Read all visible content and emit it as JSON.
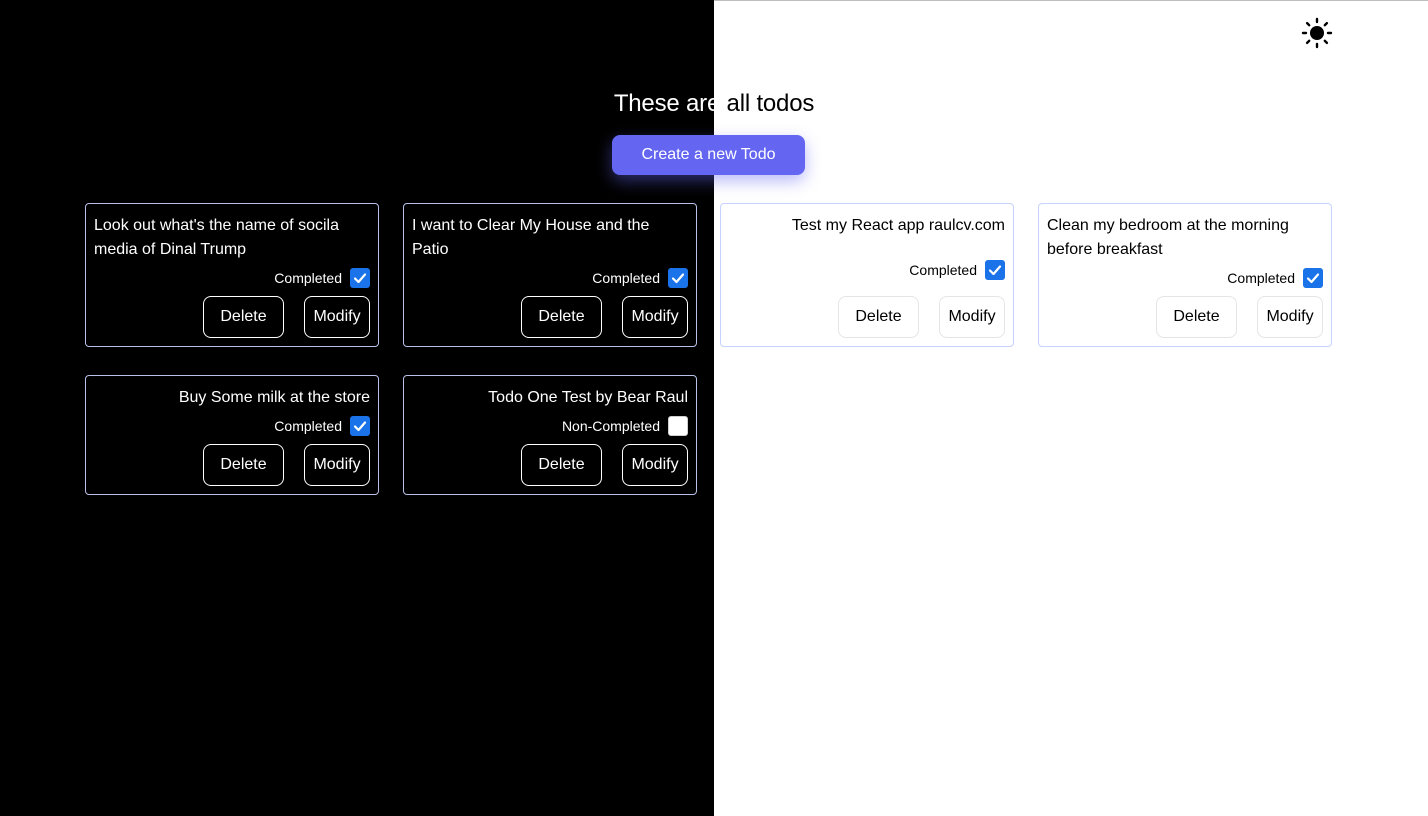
{
  "header": {
    "title": "These are all todos",
    "title_dark_part": "These are",
    "title_light_part": " all todos",
    "create_button": "Create a new Todo",
    "theme_toggle_icon": "sun-icon"
  },
  "colors": {
    "accent": "#6466f1",
    "checkbox_checked": "#1a73e8",
    "dark_background": "#000000",
    "light_background": "#ffffff"
  },
  "todos": [
    {
      "title": "Look out what's the name of socila media of Dinal Trump",
      "status": "Completed",
      "completed": true,
      "delete_label": "Delete",
      "modify_label": "Modify"
    },
    {
      "title": "I want to Clear My House and the Patio",
      "status": "Completed",
      "completed": true,
      "delete_label": "Delete",
      "modify_label": "Modify"
    },
    {
      "title": "Test my React app raulcv.com",
      "status": "Completed",
      "completed": true,
      "delete_label": "Delete",
      "modify_label": "Modify"
    },
    {
      "title": "Clean my bedroom at the morning before breakfast",
      "status": "Completed",
      "completed": true,
      "delete_label": "Delete",
      "modify_label": "Modify"
    },
    {
      "title": "Buy Some milk at the store",
      "status": "Completed",
      "completed": true,
      "delete_label": "Delete",
      "modify_label": "Modify"
    },
    {
      "title": "Todo One Test by Bear Raul",
      "status": "Non-Completed",
      "completed": false,
      "delete_label": "Delete",
      "modify_label": "Modify"
    }
  ]
}
